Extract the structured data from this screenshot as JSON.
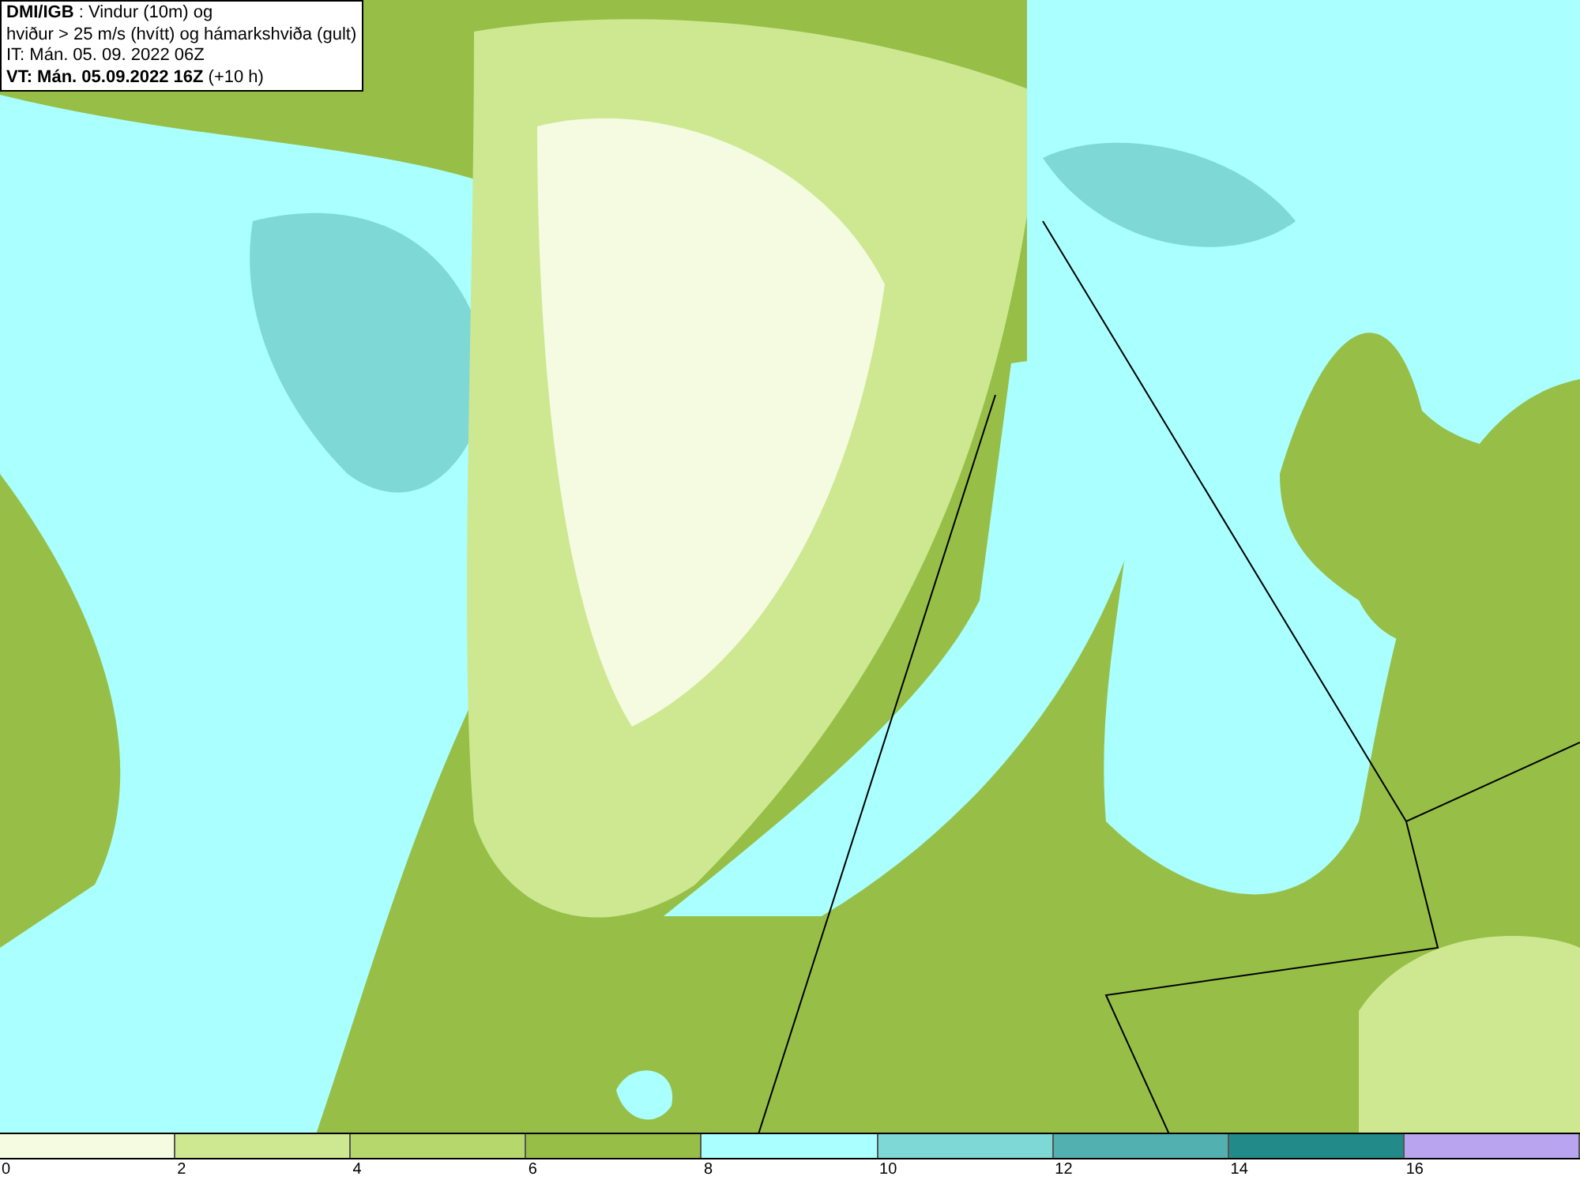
{
  "title_box": {
    "lines": [
      "**DMI/IGB** : Vindur (10m) og",
      "hviður > 25 m/s (hvítt) og hámarkshviða (gult)",
      "IT: Mán. 05. 09. 2022 06Z",
      "**VT: Mán. 05.09.2022 16Z** (+10 h)"
    ]
  },
  "legend": {
    "bins": [
      {
        "color": "#f4fbe0"
      },
      {
        "color": "#cde891"
      },
      {
        "color": "#b5d76c"
      },
      {
        "color": "#97bf47"
      },
      {
        "color": "#aaffff"
      },
      {
        "color": "#7dd8d6"
      },
      {
        "color": "#52b0b0"
      },
      {
        "color": "#228b8a"
      },
      {
        "color": "#b9a4f0"
      }
    ],
    "ticks": [
      "0",
      "2",
      "4",
      "6",
      "8",
      "10",
      "12",
      "14",
      "16"
    ]
  }
}
